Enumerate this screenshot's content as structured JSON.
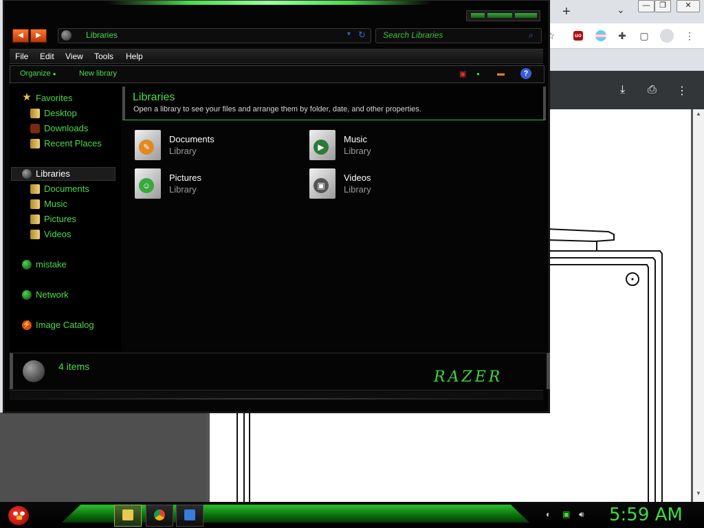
{
  "browser": {
    "new_tab_label": "+",
    "tab_dropdown": "⌄",
    "minimize": "—",
    "restore": "❐",
    "close": "✕",
    "toolbar_star": "☆",
    "toolbar_ub": "uo",
    "toolbar_puzzle": "✚",
    "toolbar_sidebar": "▢",
    "toolbar_menu": "⋮",
    "pdf_download": "⤓",
    "pdf_print": "⎙",
    "pdf_menu": "⋮"
  },
  "explorer": {
    "address": "Libraries",
    "search_placeholder": "Search Libraries",
    "menu": [
      "File",
      "Edit",
      "View",
      "Tools",
      "Help"
    ],
    "commands": {
      "organize": "Organize",
      "new_library": "New library"
    },
    "nav": {
      "favorites": "Favorites",
      "desktop": "Desktop",
      "downloads": "Downloads",
      "recent_places": "Recent Places",
      "libraries": "Libraries",
      "documents": "Documents",
      "music": "Music",
      "pictures": "Pictures",
      "videos": "Videos",
      "mistake": "mistake",
      "network": "Network",
      "image_catalog": "Image Catalog"
    },
    "header": {
      "title": "Libraries",
      "subtitle": "Open a library to see your files and arrange them by folder, date, and other properties."
    },
    "libraries": [
      {
        "name": "Documents",
        "type": "Library"
      },
      {
        "name": "Music",
        "type": "Library"
      },
      {
        "name": "Pictures",
        "type": "Library"
      },
      {
        "name": "Videos",
        "type": "Library"
      }
    ],
    "details": {
      "count": "4 items",
      "brand": "RAZER"
    }
  },
  "taskbar": {
    "clock": "5:59 AM"
  },
  "colors": {
    "accent_green": "#4cdc4c",
    "window_bg": "#050505",
    "clock_green": "#3de03d"
  }
}
